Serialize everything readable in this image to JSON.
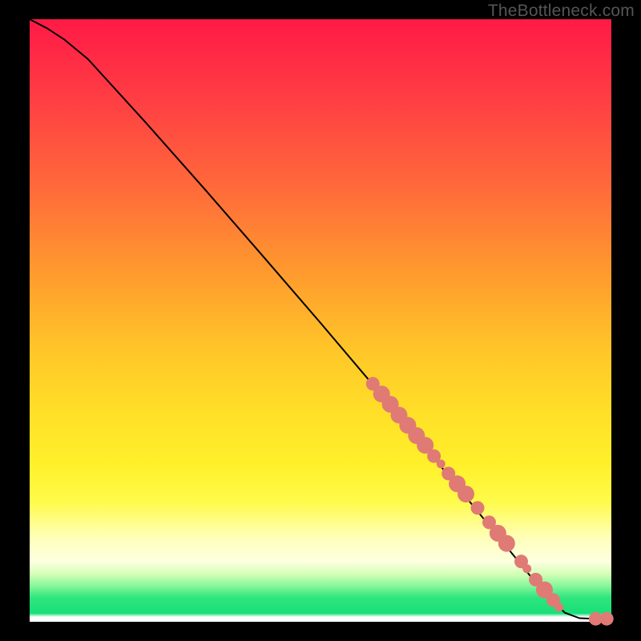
{
  "watermark": "TheBottleneck.com",
  "chart_data": {
    "type": "line",
    "title": "",
    "xlabel": "",
    "ylabel": "",
    "xlim": [
      0,
      100
    ],
    "ylim": [
      0,
      100
    ],
    "grid": false,
    "legend": false,
    "background": "vertical rainbow gradient (red→green) over black frame",
    "curve": [
      {
        "x": 0,
        "y": 100
      },
      {
        "x": 3,
        "y": 98.5
      },
      {
        "x": 6,
        "y": 96.6
      },
      {
        "x": 10,
        "y": 93.4
      },
      {
        "x": 20,
        "y": 82.8
      },
      {
        "x": 30,
        "y": 71.9
      },
      {
        "x": 40,
        "y": 60.8
      },
      {
        "x": 50,
        "y": 49.6
      },
      {
        "x": 60,
        "y": 38.2
      },
      {
        "x": 70,
        "y": 26.6
      },
      {
        "x": 80,
        "y": 14.8
      },
      {
        "x": 88,
        "y": 5.3
      },
      {
        "x": 92,
        "y": 1.5
      },
      {
        "x": 94.5,
        "y": 0.6
      },
      {
        "x": 97,
        "y": 0.5
      },
      {
        "x": 100,
        "y": 0.5
      }
    ],
    "markers": [
      {
        "x": 59.0,
        "y": 39.5,
        "size": "big"
      },
      {
        "x": 60.5,
        "y": 37.8,
        "size": "huge"
      },
      {
        "x": 62.0,
        "y": 36.1,
        "size": "huge"
      },
      {
        "x": 63.5,
        "y": 34.3,
        "size": "huge"
      },
      {
        "x": 65.0,
        "y": 32.6,
        "size": "huge"
      },
      {
        "x": 66.5,
        "y": 30.9,
        "size": "huge"
      },
      {
        "x": 68.0,
        "y": 29.3,
        "size": "huge"
      },
      {
        "x": 69.5,
        "y": 27.5,
        "size": "big"
      },
      {
        "x": 70.7,
        "y": 26.2,
        "size": "small"
      },
      {
        "x": 72.0,
        "y": 24.6,
        "size": "big"
      },
      {
        "x": 73.5,
        "y": 22.9,
        "size": "huge"
      },
      {
        "x": 75.0,
        "y": 21.2,
        "size": "huge"
      },
      {
        "x": 77.0,
        "y": 18.9,
        "size": "big"
      },
      {
        "x": 79.0,
        "y": 16.5,
        "size": "big"
      },
      {
        "x": 80.5,
        "y": 14.7,
        "size": "huge"
      },
      {
        "x": 82.0,
        "y": 13.0,
        "size": "huge"
      },
      {
        "x": 84.5,
        "y": 10.0,
        "size": "big"
      },
      {
        "x": 85.5,
        "y": 8.8,
        "size": "small"
      },
      {
        "x": 87.0,
        "y": 7.0,
        "size": "big"
      },
      {
        "x": 88.5,
        "y": 5.3,
        "size": "huge"
      },
      {
        "x": 90.0,
        "y": 3.6,
        "size": "big"
      },
      {
        "x": 91.0,
        "y": 2.4,
        "size": "small"
      },
      {
        "x": 97.3,
        "y": 0.5,
        "size": "big"
      },
      {
        "x": 99.2,
        "y": 0.5,
        "size": "big"
      }
    ]
  }
}
